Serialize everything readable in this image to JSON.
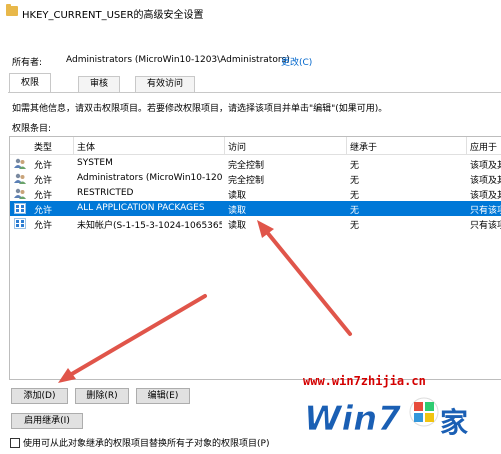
{
  "window": {
    "title": "HKEY_CURRENT_USER的高级安全设置"
  },
  "owner": {
    "label": "所有者:",
    "value": "Administrators (MicroWin10-1203\\Administrators)",
    "change_link": "更改(C)"
  },
  "tabs": [
    {
      "label": "权限",
      "active": true
    },
    {
      "label": "审核",
      "active": false
    },
    {
      "label": "有效访问",
      "active": false
    }
  ],
  "info_text": "如需其他信息，请双击权限项目。若要修改权限项目，请选择该项目并单击\"编辑\"(如果可用)。",
  "entries_label": "权限条目:",
  "table": {
    "columns": [
      "类型",
      "主体",
      "访问",
      "继承于",
      "应用于"
    ],
    "rows": [
      {
        "type": "允许",
        "principal": "SYSTEM",
        "access": "完全控制",
        "inherited": "无",
        "applies": "该项及其",
        "icon": "users-icon",
        "selected": false
      },
      {
        "type": "允许",
        "principal": "Administrators (MicroWin10-120...",
        "access": "完全控制",
        "inherited": "无",
        "applies": "该项及其",
        "icon": "users-icon",
        "selected": false
      },
      {
        "type": "允许",
        "principal": "RESTRICTED",
        "access": "读取",
        "inherited": "无",
        "applies": "该项及其",
        "icon": "users-icon",
        "selected": false
      },
      {
        "type": "允许",
        "principal": "ALL APPLICATION PACKAGES",
        "access": "读取",
        "inherited": "无",
        "applies": "只有该项",
        "icon": "app-package-icon",
        "selected": true
      },
      {
        "type": "允许",
        "principal": "未知帐户(S-1-15-3-1024-1065365...",
        "access": "读取",
        "inherited": "无",
        "applies": "只有该项",
        "icon": "app-package-icon",
        "selected": false
      }
    ]
  },
  "buttons": {
    "add": "添加(D)",
    "remove": "删除(R)",
    "edit": "编辑(E)",
    "enable_inheritance": "启用继承(I)"
  },
  "bottom_checkbox": {
    "label": "使用可从此对象继承的权限项目替换所有子对象的权限项目(P)",
    "checked": false
  },
  "watermark": {
    "url": "www.win7zhijia.cn",
    "logo_text": "Win7",
    "logo_suffix": "家"
  },
  "colors": {
    "selection": "#0078d7",
    "arrow": "#e0554a",
    "link": "#0066cc",
    "watermark_red": "#d40000",
    "watermark_blue": "#1a5fb4"
  }
}
